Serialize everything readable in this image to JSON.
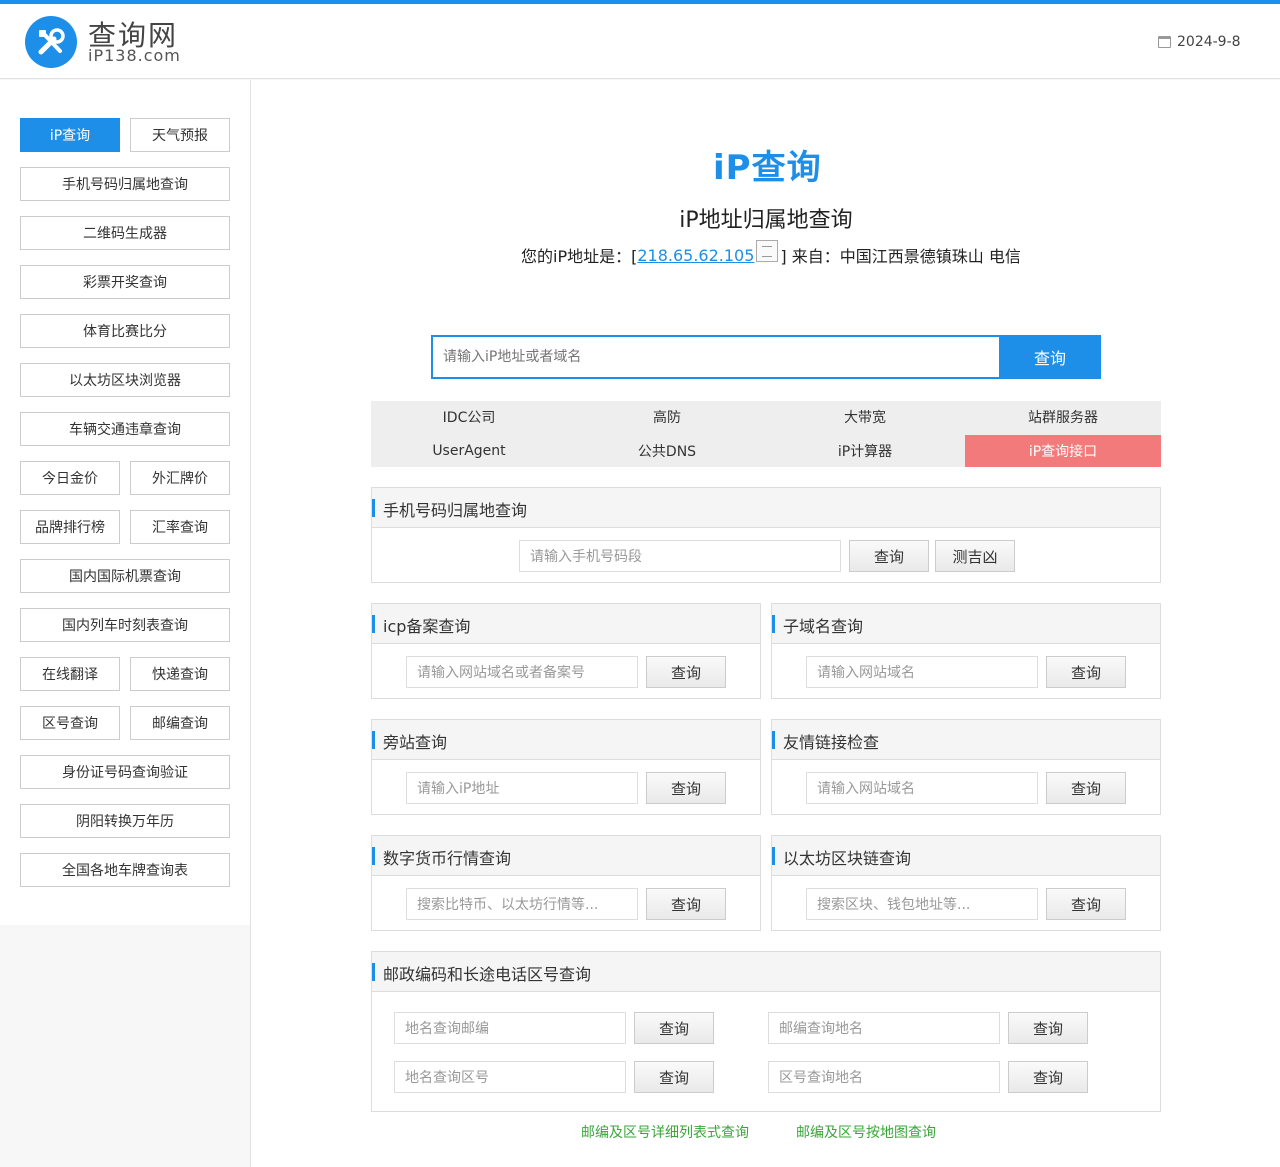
{
  "header": {
    "title": "查询网",
    "domain": "iP138.com",
    "date": "2024-9-8"
  },
  "sidebar": {
    "items": [
      {
        "label": "iP查询",
        "active": true
      },
      {
        "label": "天气预报"
      },
      {
        "label": "手机号码归属地查询"
      },
      {
        "label": "二维码生成器"
      },
      {
        "label": "彩票开奖查询"
      },
      {
        "label": "体育比赛比分"
      },
      {
        "label": "以太坊区块浏览器"
      },
      {
        "label": "车辆交通违章查询"
      },
      {
        "label": "今日金价"
      },
      {
        "label": "外汇牌价"
      },
      {
        "label": "品牌排行榜"
      },
      {
        "label": "汇率查询"
      },
      {
        "label": "国内国际机票查询"
      },
      {
        "label": "国内列车时刻表查询"
      },
      {
        "label": "在线翻译"
      },
      {
        "label": "快递查询"
      },
      {
        "label": "区号查询"
      },
      {
        "label": "邮编查询"
      },
      {
        "label": "身份证号码查询验证"
      },
      {
        "label": "阴阳转换万年历"
      },
      {
        "label": "全国各地车牌查询表"
      }
    ]
  },
  "main": {
    "logo": "iP查询",
    "subtitle": "iP地址归属地查询",
    "ip_prefix": "您的iP地址是：[",
    "ip": "218.65.62.105",
    "ip_suffix": "] 来自：中国江西景德镇珠山 电信",
    "search_placeholder": "请输入iP地址或者域名",
    "search_button": "查询",
    "quick_links": [
      "IDC公司",
      "高防",
      "大带宽",
      "站群服务器",
      "UserAgent",
      "公共DNS",
      "iP计算器",
      "iP查询接口"
    ],
    "highlight_color": "#f37a7a",
    "accent_color": "#1e8fe8"
  },
  "panels": {
    "phone": {
      "title": "手机号码归属地查询",
      "placeholder": "请输入手机号码段",
      "button": "查询",
      "button2": "测吉凶"
    },
    "icp": {
      "title": "icp备案查询",
      "placeholder": "请输入网站域名或者备案号",
      "button": "查询"
    },
    "subdomain": {
      "title": "子域名查询",
      "placeholder": "请输入网站域名",
      "button": "查询"
    },
    "sidesite": {
      "title": "旁站查询",
      "placeholder": "请输入iP地址",
      "button": "查询"
    },
    "friendlink": {
      "title": "友情链接检查",
      "placeholder": "请输入网站域名",
      "button": "查询"
    },
    "crypto": {
      "title": "数字货币行情查询",
      "placeholder": "搜索比特币、以太坊行情等...",
      "button": "查询"
    },
    "eth": {
      "title": "以太坊区块链查询",
      "placeholder": "搜索区块、钱包地址等...",
      "button": "查询"
    },
    "postal": {
      "title": "邮政编码和长途电话区号查询",
      "ph1": "地名查询邮编",
      "ph2": "邮编查询地名",
      "ph3": "地名查询区号",
      "ph4": "区号查询地名",
      "button": "查询"
    }
  },
  "footer_links": {
    "list": "邮编及区号详细列表式查询",
    "map": "邮编及区号按地图查询"
  }
}
